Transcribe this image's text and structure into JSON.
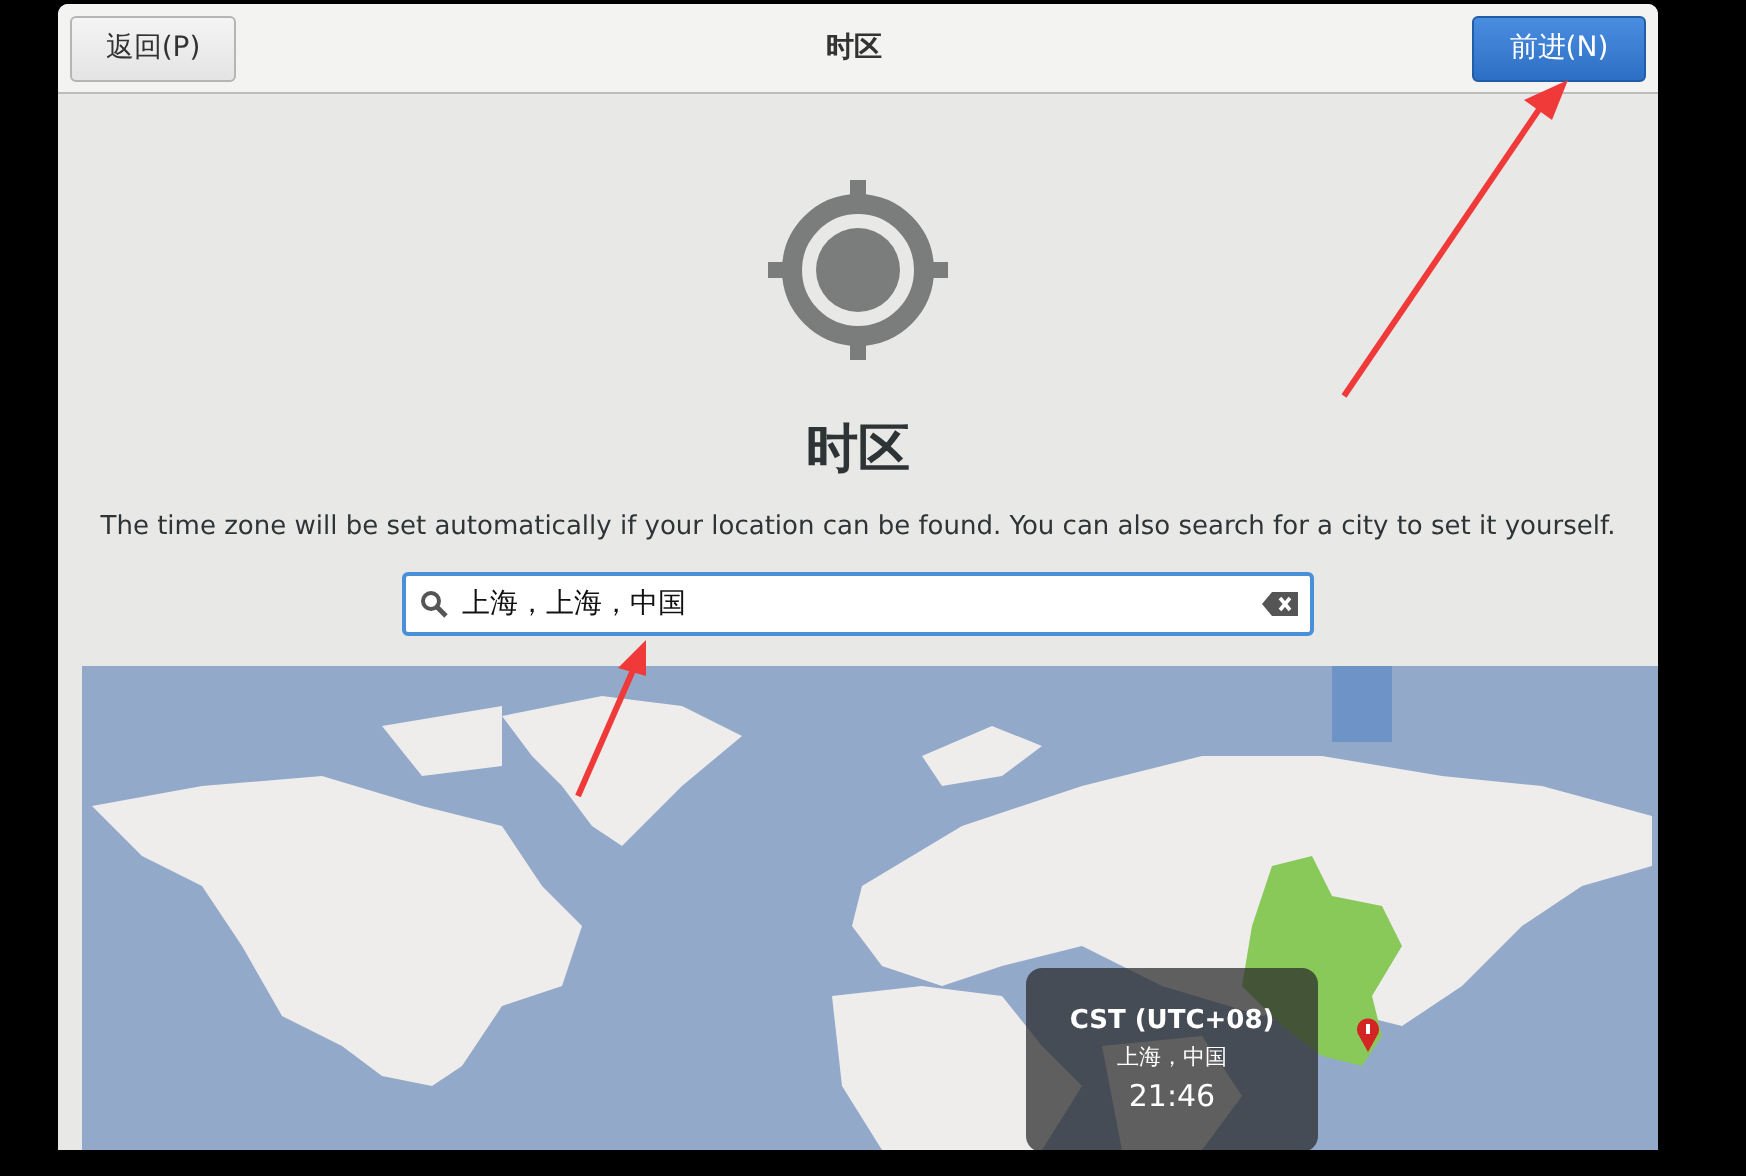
{
  "window": {
    "title": "时区"
  },
  "buttons": [
    {
      "label": "返回(P)",
      "kind": "back"
    },
    {
      "label": "前进(N)",
      "kind": "next"
    }
  ],
  "heading": "时区",
  "description": "The time zone will be set automatically if your location can be found. You can also search for a city to set it yourself.",
  "search": {
    "value": "上海，上海，中国"
  },
  "map": {
    "tooltip": {
      "zone": "CST (UTC+08)",
      "place": "上海，中国",
      "time": "21:46"
    }
  }
}
